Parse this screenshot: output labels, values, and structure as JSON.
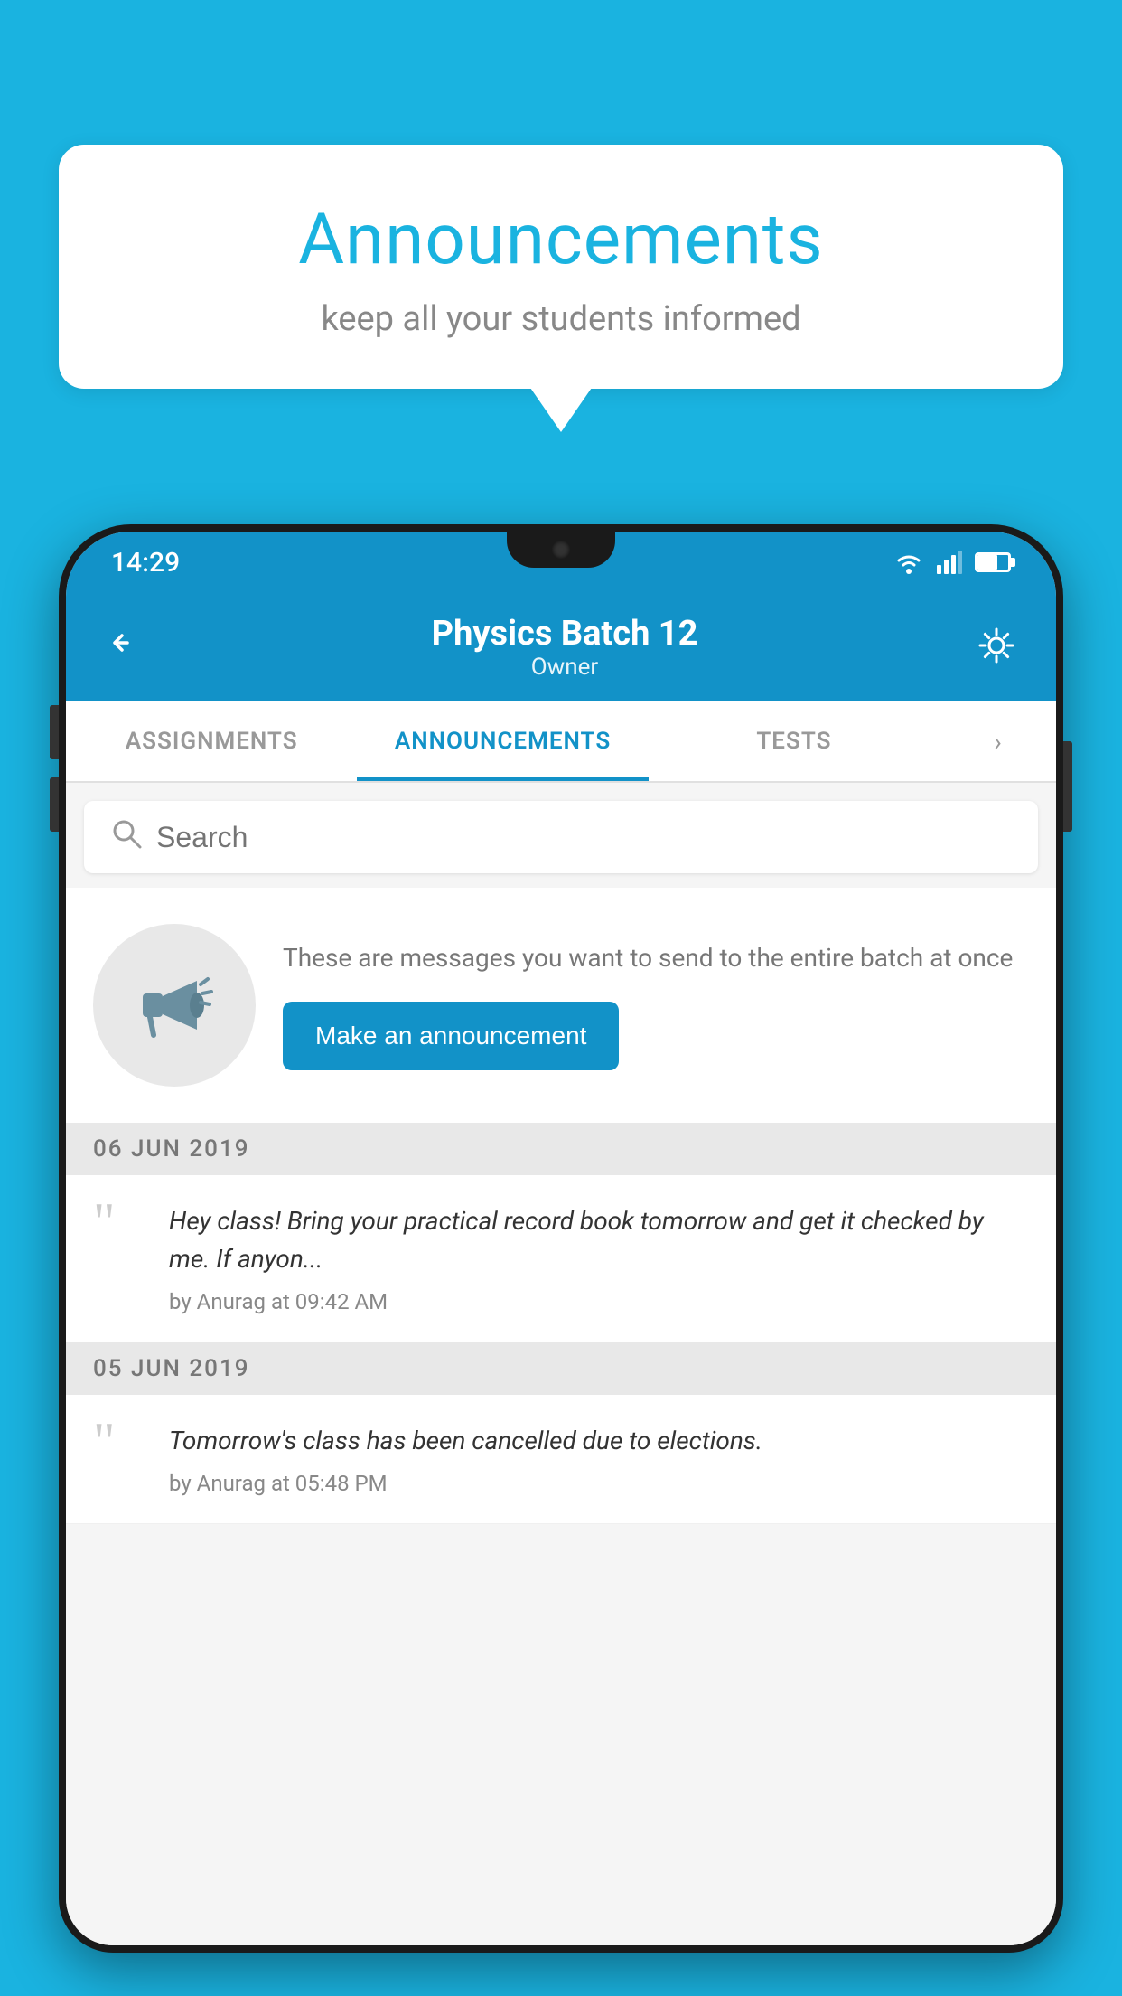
{
  "background_color": "#1ab3e0",
  "speech_bubble": {
    "title": "Announcements",
    "subtitle": "keep all your students informed"
  },
  "phone": {
    "status_bar": {
      "time": "14:29"
    },
    "header": {
      "title": "Physics Batch 12",
      "subtitle": "Owner",
      "back_label": "←",
      "settings_label": "⚙"
    },
    "tabs": [
      {
        "label": "ASSIGNMENTS",
        "active": false
      },
      {
        "label": "ANNOUNCEMENTS",
        "active": true
      },
      {
        "label": "TESTS",
        "active": false
      }
    ],
    "search": {
      "placeholder": "Search"
    },
    "promo": {
      "description": "These are messages you want to send to the entire batch at once",
      "button_label": "Make an announcement"
    },
    "announcements": [
      {
        "date": "06  JUN  2019",
        "text": "Hey class! Bring your practical record book tomorrow and get it checked by me. If anyon...",
        "meta": "by Anurag at 09:42 AM"
      },
      {
        "date": "05  JUN  2019",
        "text": "Tomorrow's class has been cancelled due to elections.",
        "meta": "by Anurag at 05:48 PM"
      }
    ]
  }
}
